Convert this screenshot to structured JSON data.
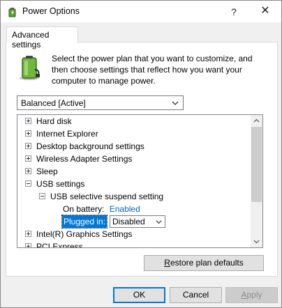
{
  "window": {
    "title": "Power Options",
    "help_glyph": "?",
    "close_glyph": "✕"
  },
  "tab": {
    "label": "Advanced settings"
  },
  "description": {
    "lines": [
      "Select the power plan that you want to customize, and",
      "then choose settings that reflect how you want your",
      "computer to manage power."
    ]
  },
  "plan_select": {
    "value": "Balanced [Active]"
  },
  "tree": {
    "items": [
      {
        "label": "Hard disk",
        "state": "collapsed"
      },
      {
        "label": "Internet Explorer",
        "state": "collapsed"
      },
      {
        "label": "Desktop background settings",
        "state": "collapsed"
      },
      {
        "label": "Wireless Adapter Settings",
        "state": "collapsed"
      },
      {
        "label": "Sleep",
        "state": "collapsed"
      },
      {
        "label": "USB settings",
        "state": "expanded"
      },
      {
        "label": "USB selective suspend setting",
        "state": "expanded"
      },
      {
        "label": "Intel(R) Graphics Settings",
        "state": "collapsed"
      },
      {
        "label": "PCI Express",
        "state": "collapsed"
      }
    ],
    "on_battery": {
      "label": "On battery:",
      "value": "Enabled"
    },
    "plugged_in": {
      "label": "Plugged in:",
      "value": "Disabled"
    }
  },
  "buttons": {
    "restore_prefix": "R",
    "restore_rest": "estore plan defaults",
    "ok": "OK",
    "cancel": "Cancel",
    "apply_prefix": "A",
    "apply_rest": "pply"
  },
  "colors": {
    "link": "#0067c0",
    "selection": "#0078d7"
  }
}
